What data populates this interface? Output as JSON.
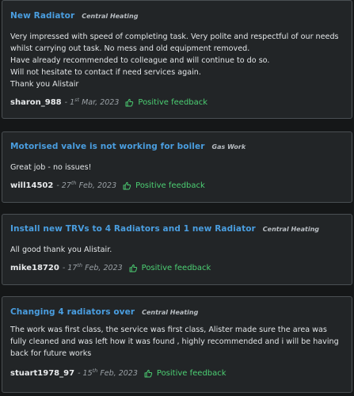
{
  "reviews": [
    {
      "title": "New Radiator",
      "category": "Central Heating",
      "body": [
        "Very impressed with speed of completing task. Very polite and respectful of our needs whilst carrying out task. No mess and old equipment removed.",
        "Have already recommended to colleague and will continue to do so.",
        "Will not hesitate to contact if need services again.",
        "Thank you Alistair"
      ],
      "user": "sharon_988",
      "separator": "-",
      "date_day": "1",
      "date_suffix": "st",
      "date_rest": "Mar, 2023",
      "feedback": "Positive feedback",
      "feedback_icon": "thumbs-up-icon"
    },
    {
      "title": "Motorised valve is not working for boiler",
      "category": "Gas Work",
      "body": [
        "Great job - no issues!"
      ],
      "user": "will14502",
      "separator": "-",
      "date_day": "27",
      "date_suffix": "th",
      "date_rest": "Feb, 2023",
      "feedback": "Positive feedback",
      "feedback_icon": "thumbs-up-icon"
    },
    {
      "title": "Install new TRVs to 4 Radiators and 1 new Radiator",
      "category": "Central Heating",
      "body": [
        "All good thank you Alistair."
      ],
      "user": "mike18720",
      "separator": "-",
      "date_day": "17",
      "date_suffix": "th",
      "date_rest": "Feb, 2023",
      "feedback": "Positive feedback",
      "feedback_icon": "thumbs-up-icon"
    },
    {
      "title": "Changing 4 radiators over",
      "category": "Central Heating",
      "body": [
        "The work was first class, the service was first class, Alister made sure the area was fully cleaned and was left how it was found , highly recommended and i will be having back for future works"
      ],
      "user": "stuart1978_97",
      "separator": "-",
      "date_day": "15",
      "date_suffix": "th",
      "date_rest": "Feb, 2023",
      "feedback": "Positive feedback",
      "feedback_icon": "thumbs-up-icon"
    }
  ],
  "colors": {
    "background": "#151718",
    "card": "#222527",
    "card_border": "#4a4f53",
    "title": "#4a9ee0",
    "positive": "#4ccf73"
  }
}
